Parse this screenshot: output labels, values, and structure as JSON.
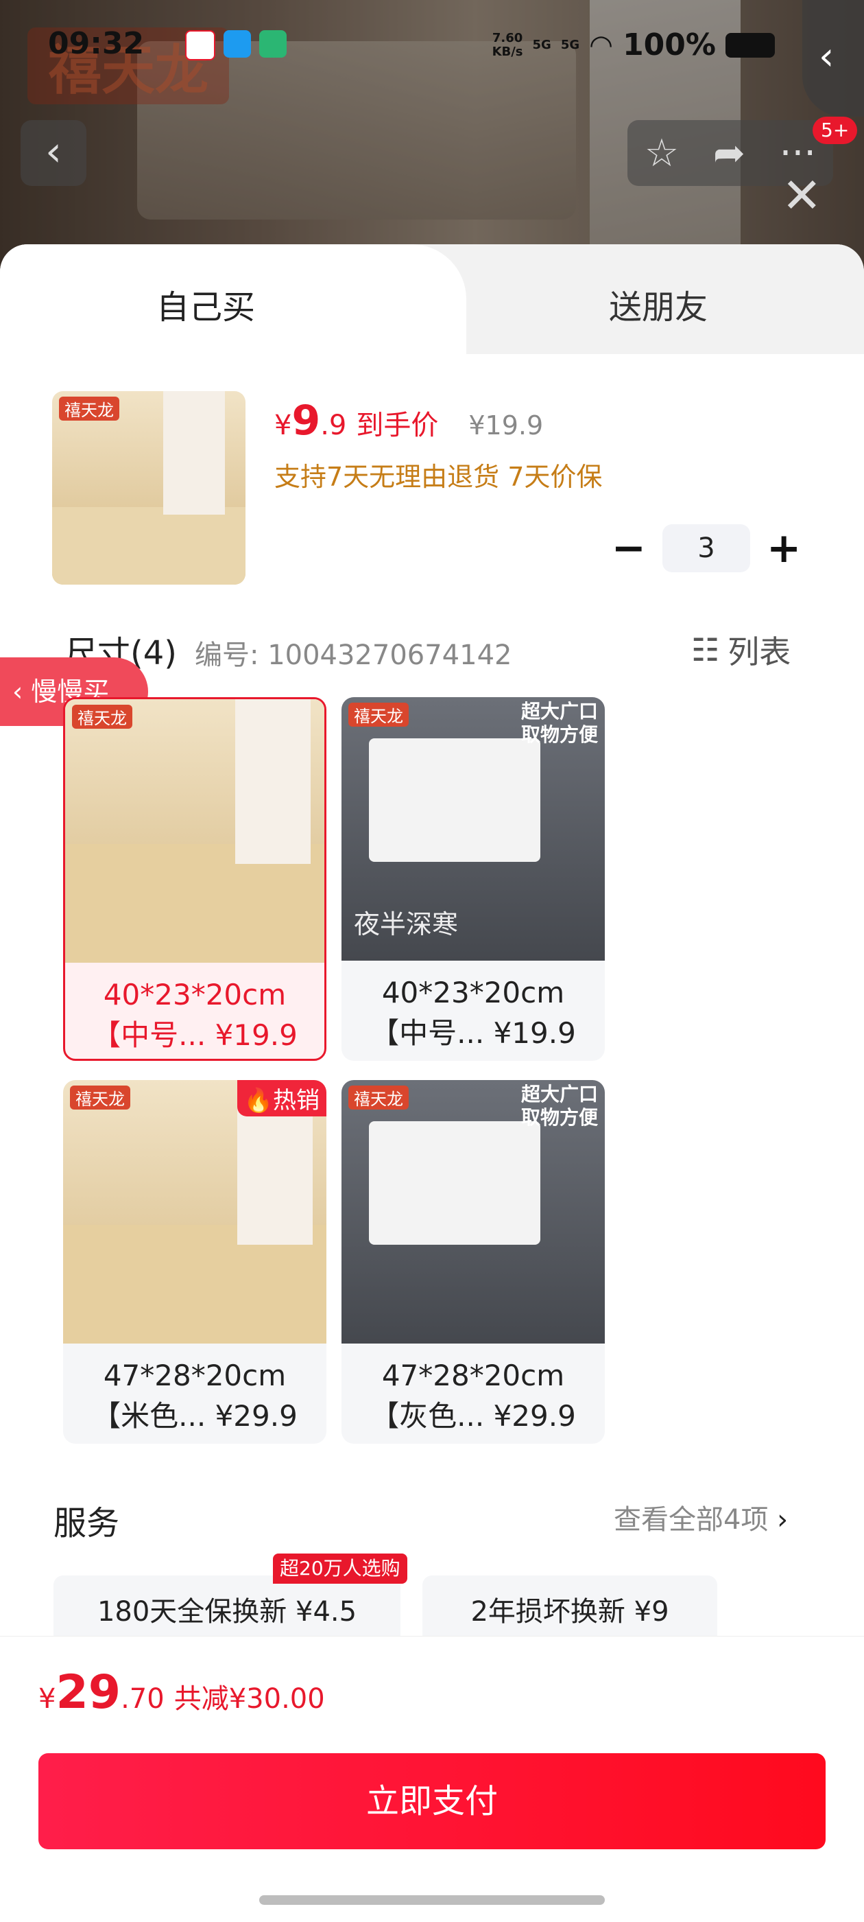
{
  "status_bar": {
    "time": "09:32",
    "speed_top": "7.60",
    "speed_bottom": "KB/s",
    "net1": "5G",
    "net2": "5G",
    "battery": "100%"
  },
  "header": {
    "back_icon": "chevron-left-icon",
    "favorite_icon": "star-icon",
    "share_icon": "share-icon",
    "more_icon": "more-icon",
    "notif_badge": "5+",
    "close_icon": "close-icon"
  },
  "tabs": {
    "self_buy": "自己买",
    "gift_friend": "送朋友"
  },
  "product": {
    "price_symbol": "¥",
    "price_int": "9",
    "price_dec": ".9",
    "price_tag": "到手价",
    "orig_price": "¥19.9",
    "promise": "支持7天无理由退货  7天价保",
    "quantity": "3",
    "minus": "−",
    "plus": "+"
  },
  "size_section": {
    "title": "尺寸(4)",
    "code": "编号: 10043270674142",
    "list_label": "列表"
  },
  "slow_buy": "慢慢买",
  "options": [
    {
      "line1": "40*23*20cm",
      "line2": "【中号... ¥19.9",
      "selected": true,
      "style": "beige",
      "hot": "",
      "corner": "",
      "logo": "禧天龙"
    },
    {
      "line1": "40*23*20cm",
      "line2": "【中号... ¥19.9",
      "selected": false,
      "style": "grey",
      "hot": "",
      "corner": "超大广口\n取物方便",
      "logo": "禧天龙",
      "watermark": "夜半深寒"
    },
    {
      "line1": "47*28*20cm",
      "line2": "【米色... ¥29.9",
      "selected": false,
      "style": "beige",
      "hot": "热销",
      "corner": "",
      "logo": "禧天龙"
    },
    {
      "line1": "47*28*20cm",
      "line2": "【灰色... ¥29.9",
      "selected": false,
      "style": "grey",
      "hot": "",
      "corner": "超大广口\n取物方便",
      "logo": "禧天龙"
    }
  ],
  "service": {
    "title": "服务",
    "more": "查看全部4项",
    "badge": "超20万人选购",
    "items": [
      "180天全保换新  ¥4.5",
      "2年损坏换新  ¥9"
    ]
  },
  "footer": {
    "symbol": "¥",
    "total_int": "29",
    "total_dec": ".70",
    "reduce": "共减¥30.00",
    "pay_label": "立即支付"
  },
  "colors": {
    "accent": "#e8182c",
    "promise": "#c67d17"
  }
}
